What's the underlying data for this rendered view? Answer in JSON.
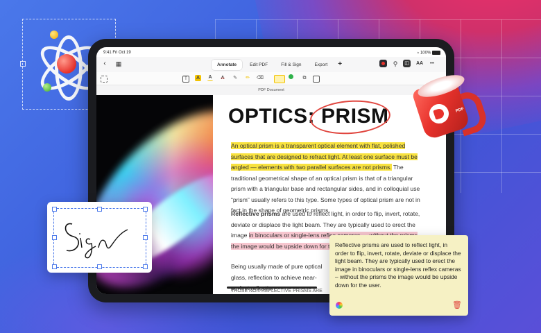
{
  "status_bar": {
    "time": "9:41  Fri Oct 19",
    "battery": "100%"
  },
  "nav": {
    "tabs": [
      {
        "label": "Annotate",
        "active": true
      },
      {
        "label": "Edit PDF",
        "active": false
      },
      {
        "label": "Fill & Sign",
        "active": false
      },
      {
        "label": "Export",
        "active": false
      }
    ],
    "add_label": "+",
    "back_icon": "chevron-left-icon",
    "grid_icon": "grid-icon",
    "right_icons": [
      "profile-icon",
      "search-icon",
      "reader-icon",
      "text-size-icon",
      "more-icon"
    ],
    "text_size_label": "AA",
    "more_label": "•••"
  },
  "toolbar": {
    "icons": [
      "select-icon",
      "text-box-icon",
      "highlight-icon",
      "underline-icon",
      "strikethrough-icon",
      "pencil-icon",
      "marker-icon",
      "eraser-icon",
      "comment-icon",
      "color-dot-icon",
      "shapes-icon",
      "sticker-icon"
    ],
    "accent_color": "#f2c200",
    "dot_color": "#2fb24a"
  },
  "document": {
    "label": "PDF Document",
    "title_prefix": "OPTICS:",
    "title_word": "PRISM",
    "p1_highlighted": "An optical prism is a transparent optical element with flat, polished surfaces that are designed to refract light. At least one surface must be angled — elements with two parallel surfaces are not prisms.",
    "p1_rest": " The traditional geometrical shape of an optical prism is that of a triangular prism with a triangular base and rectangular sides, and in colloquial use “prism” usually refers to this type. Some types of optical prism are not in fact in the shape of geometric prisms.",
    "p2_bold": "Reflective prisms",
    "p2_plain": " are used to reflect light, in order to flip, invert, rotate, deviate or displace the light beam. They are typically used to erect the image ",
    "p2_highlighted": "in binoculars or single-lens reflex cameras — without the prisms the image would be upside down for the user.",
    "p3": "Being usually made of pure optical glass, reflection to achieve near-perfect reflection",
    "p3_cut": "THOSE NON-REFLECTIVE PRISMS ARE"
  },
  "note": {
    "text": "Reflective prisms are used to reflect light, in order to flip, invert, rotate, deviate or displace the light beam. They are typically used to erect the image in binoculars or single-lens reflex cameras – without the prisms the image would be upside down for the user.",
    "background": "#f6f1c4",
    "icons": [
      "color-picker-icon",
      "trash-icon"
    ]
  },
  "signature": {
    "text": "Sign",
    "ink_color": "#111111",
    "selection_color": "#4a78ea"
  },
  "mug": {
    "label": "PDF"
  },
  "colors": {
    "background": "#4063df",
    "highlight_yellow": "#f8e240",
    "highlight_pink": "#f7c6cf",
    "annotation_red": "#e0453e"
  }
}
